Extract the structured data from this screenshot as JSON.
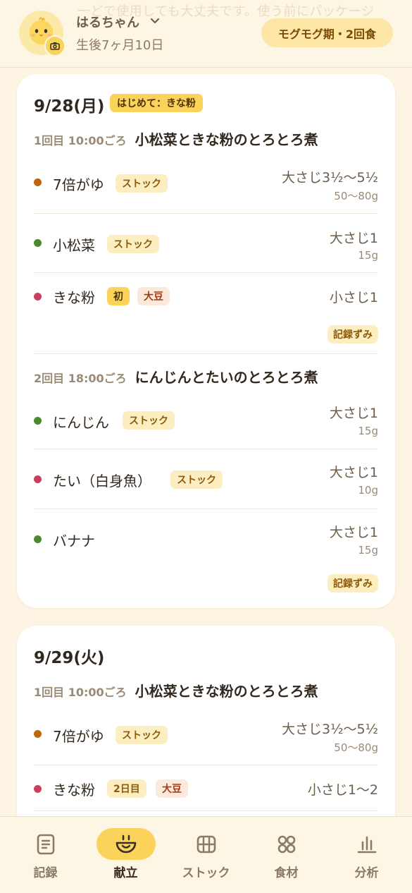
{
  "header": {
    "ghost_text": "一どで使用しても大丈夫です。使う前にパッケージ",
    "baby_name": "はるちゃん",
    "baby_age": "生後7ヶ月10日",
    "stage": "モグモグ期・2回食"
  },
  "days": [
    {
      "date": "9/28(月)",
      "first_food": "はじめて：きな粉",
      "meals": [
        {
          "when": "1回目 10:00ごろ",
          "dish": "小松菜ときな粉のとろとろ煮",
          "items": [
            {
              "name": "7倍がゆ",
              "tags": [
                "ストック"
              ],
              "amount": "大さじ3½〜5½",
              "grams": "50〜80g",
              "dot": "#c0650f"
            },
            {
              "name": "小松菜",
              "tags": [
                "ストック"
              ],
              "amount": "大さじ1",
              "grams": "15g",
              "dot": "#4a8a2f"
            },
            {
              "name": "きな粉",
              "tags": [
                "初",
                "大豆"
              ],
              "amount": "小さじ1",
              "grams": "",
              "dot": "#c9405e"
            }
          ],
          "status": "記録ずみ"
        },
        {
          "when": "2回目 18:00ごろ",
          "dish": "にんじんとたいのとろとろ煮",
          "items": [
            {
              "name": "にんじん",
              "tags": [
                "ストック"
              ],
              "amount": "大さじ1",
              "grams": "15g",
              "dot": "#4a8a2f"
            },
            {
              "name": "たい（白身魚）",
              "tags": [
                "ストック"
              ],
              "amount": "大さじ1",
              "grams": "10g",
              "dot": "#c9405e"
            },
            {
              "name": "バナナ",
              "tags": [],
              "amount": "大さじ1",
              "grams": "15g",
              "dot": "#4a8a2f"
            }
          ],
          "status": "記録ずみ"
        }
      ]
    },
    {
      "date": "9/29(火)",
      "meals": [
        {
          "when": "1回目 10:00ごろ",
          "dish": "小松菜ときな粉のとろとろ煮",
          "items": [
            {
              "name": "7倍がゆ",
              "tags": [
                "ストック"
              ],
              "amount": "大さじ3½〜5½",
              "grams": "50〜80g",
              "dot": "#c0650f"
            },
            {
              "name": "きな粉",
              "tags": [
                "2日目",
                "大豆"
              ],
              "amount": "小さじ1〜2",
              "grams": "",
              "dot": "#c9405e"
            }
          ]
        }
      ]
    }
  ],
  "nav": {
    "items": [
      {
        "label": "記録",
        "icon": "record-icon",
        "active": false
      },
      {
        "label": "献立",
        "icon": "menu-bowl-icon",
        "active": true
      },
      {
        "label": "ストック",
        "icon": "stock-grid-icon",
        "active": false
      },
      {
        "label": "食材",
        "icon": "ingredients-icon",
        "active": false
      },
      {
        "label": "分析",
        "icon": "analysis-chart-icon",
        "active": false
      }
    ]
  }
}
